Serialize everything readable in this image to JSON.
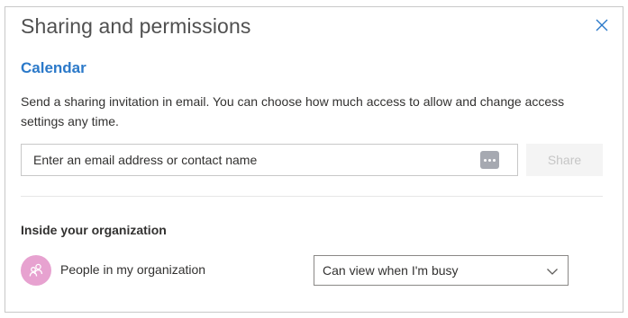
{
  "dialog": {
    "title": "Sharing and permissions",
    "close_icon": "close-icon"
  },
  "calendar": {
    "heading": "Calendar",
    "description": "Send a sharing invitation in email. You can choose how much access to allow and change access settings any time."
  },
  "invite": {
    "placeholder": "Enter an email address or contact name",
    "value": "",
    "more_icon": "more-ellipsis-icon",
    "share_label": "Share",
    "share_enabled": false
  },
  "organization": {
    "heading": "Inside your organization",
    "entries": [
      {
        "label": "People in my organization",
        "avatar_icon": "people-icon",
        "avatar_color": "#e7a2d0",
        "permission": "Can view when I'm busy"
      }
    ]
  },
  "colors": {
    "accent": "#2b79c9",
    "disabled_text": "#c6c6c6",
    "border": "#c8c8c8"
  }
}
